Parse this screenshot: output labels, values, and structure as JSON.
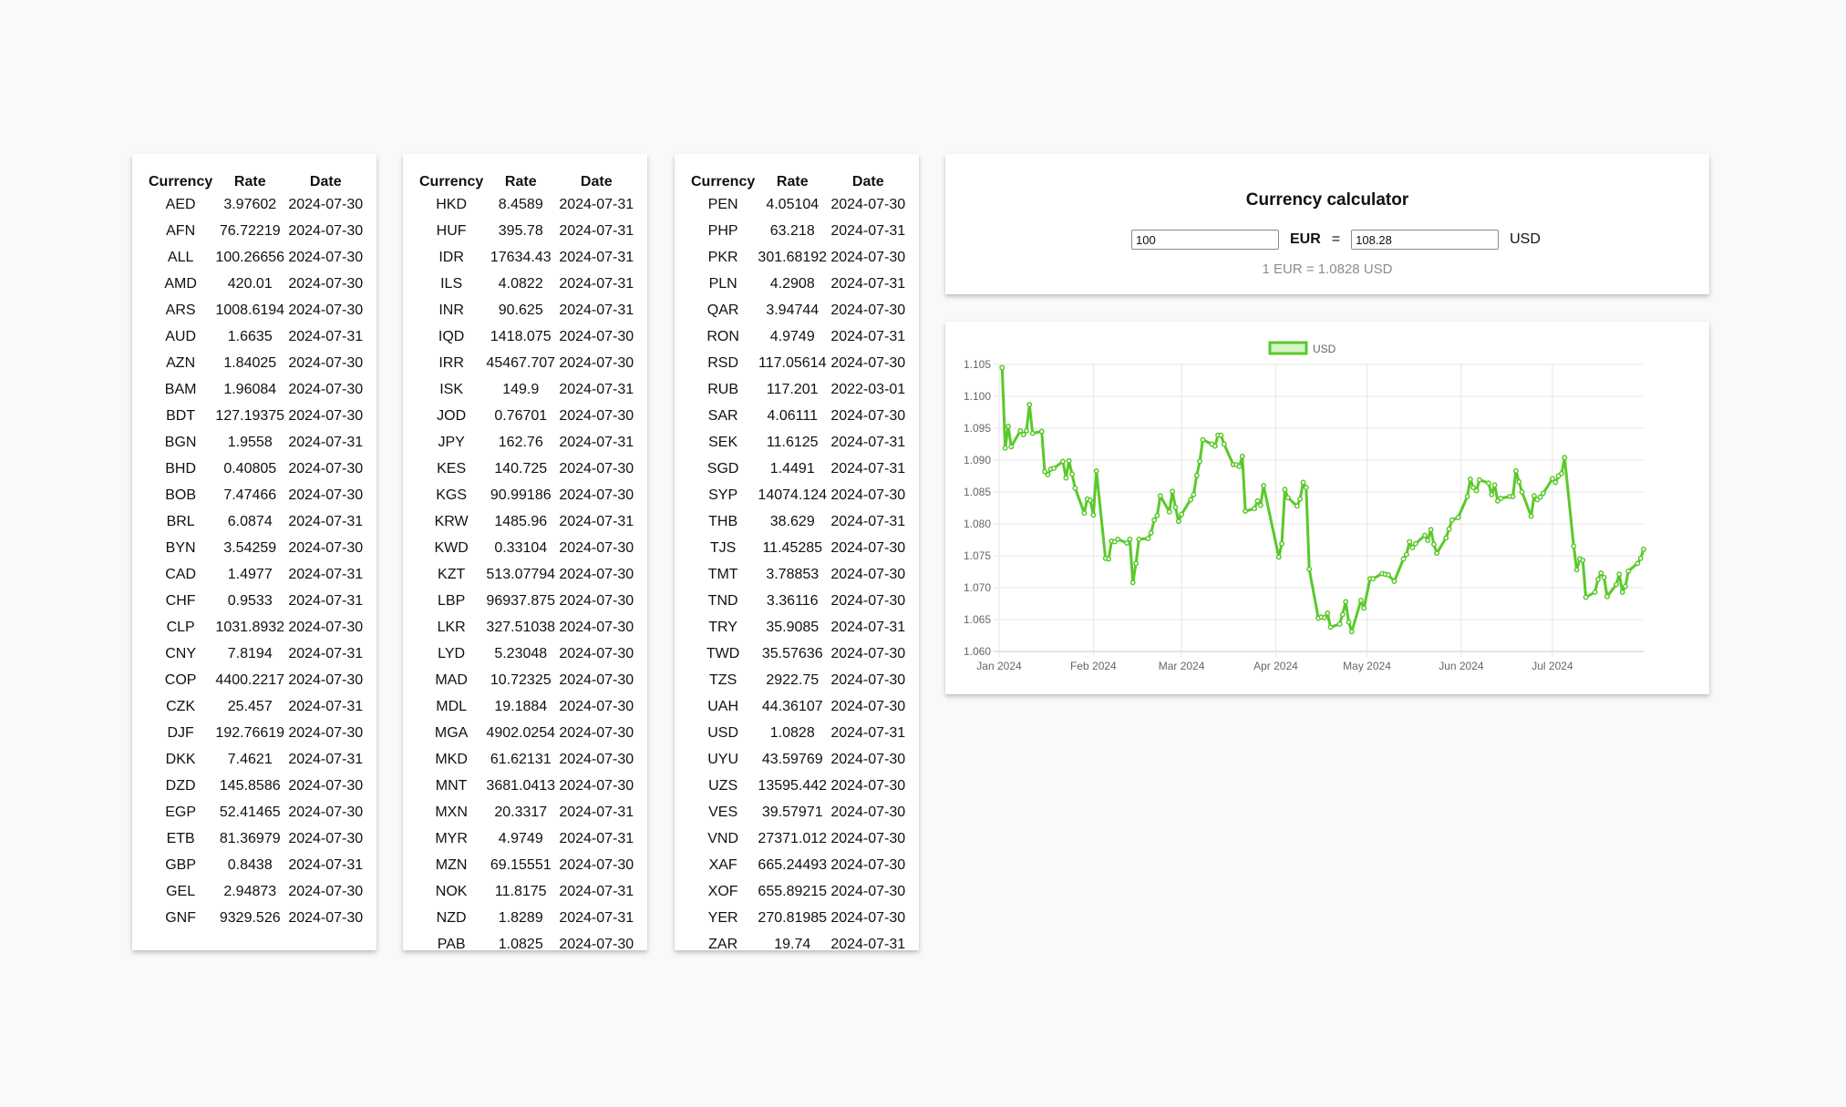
{
  "tables": [
    {
      "headers": {
        "currency": "Currency",
        "rate": "Rate",
        "date": "Date"
      },
      "rows": [
        [
          "AED",
          "3.97602",
          "2024-07-30"
        ],
        [
          "AFN",
          "76.72219",
          "2024-07-30"
        ],
        [
          "ALL",
          "100.26656",
          "2024-07-30"
        ],
        [
          "AMD",
          "420.01",
          "2024-07-30"
        ],
        [
          "ARS",
          "1008.6194",
          "2024-07-30"
        ],
        [
          "AUD",
          "1.6635",
          "2024-07-31"
        ],
        [
          "AZN",
          "1.84025",
          "2024-07-30"
        ],
        [
          "BAM",
          "1.96084",
          "2024-07-30"
        ],
        [
          "BDT",
          "127.19375",
          "2024-07-30"
        ],
        [
          "BGN",
          "1.9558",
          "2024-07-31"
        ],
        [
          "BHD",
          "0.40805",
          "2024-07-30"
        ],
        [
          "BOB",
          "7.47466",
          "2024-07-30"
        ],
        [
          "BRL",
          "6.0874",
          "2024-07-31"
        ],
        [
          "BYN",
          "3.54259",
          "2024-07-30"
        ],
        [
          "CAD",
          "1.4977",
          "2024-07-31"
        ],
        [
          "CHF",
          "0.9533",
          "2024-07-31"
        ],
        [
          "CLP",
          "1031.8932",
          "2024-07-30"
        ],
        [
          "CNY",
          "7.8194",
          "2024-07-31"
        ],
        [
          "COP",
          "4400.2217",
          "2024-07-30"
        ],
        [
          "CZK",
          "25.457",
          "2024-07-31"
        ],
        [
          "DJF",
          "192.76619",
          "2024-07-30"
        ],
        [
          "DKK",
          "7.4621",
          "2024-07-31"
        ],
        [
          "DZD",
          "145.8586",
          "2024-07-30"
        ],
        [
          "EGP",
          "52.41465",
          "2024-07-30"
        ],
        [
          "ETB",
          "81.36979",
          "2024-07-30"
        ],
        [
          "GBP",
          "0.8438",
          "2024-07-31"
        ],
        [
          "GEL",
          "2.94873",
          "2024-07-30"
        ],
        [
          "GNF",
          "9329.526",
          "2024-07-30"
        ]
      ]
    },
    {
      "headers": {
        "currency": "Currency",
        "rate": "Rate",
        "date": "Date"
      },
      "rows": [
        [
          "HKD",
          "8.4589",
          "2024-07-31"
        ],
        [
          "HUF",
          "395.78",
          "2024-07-31"
        ],
        [
          "IDR",
          "17634.43",
          "2024-07-31"
        ],
        [
          "ILS",
          "4.0822",
          "2024-07-31"
        ],
        [
          "INR",
          "90.625",
          "2024-07-31"
        ],
        [
          "IQD",
          "1418.075",
          "2024-07-30"
        ],
        [
          "IRR",
          "45467.707",
          "2024-07-30"
        ],
        [
          "ISK",
          "149.9",
          "2024-07-31"
        ],
        [
          "JOD",
          "0.76701",
          "2024-07-30"
        ],
        [
          "JPY",
          "162.76",
          "2024-07-31"
        ],
        [
          "KES",
          "140.725",
          "2024-07-30"
        ],
        [
          "KGS",
          "90.99186",
          "2024-07-30"
        ],
        [
          "KRW",
          "1485.96",
          "2024-07-31"
        ],
        [
          "KWD",
          "0.33104",
          "2024-07-30"
        ],
        [
          "KZT",
          "513.07794",
          "2024-07-30"
        ],
        [
          "LBP",
          "96937.875",
          "2024-07-30"
        ],
        [
          "LKR",
          "327.51038",
          "2024-07-30"
        ],
        [
          "LYD",
          "5.23048",
          "2024-07-30"
        ],
        [
          "MAD",
          "10.72325",
          "2024-07-30"
        ],
        [
          "MDL",
          "19.1884",
          "2024-07-30"
        ],
        [
          "MGA",
          "4902.0254",
          "2024-07-30"
        ],
        [
          "MKD",
          "61.62131",
          "2024-07-30"
        ],
        [
          "MNT",
          "3681.0413",
          "2024-07-30"
        ],
        [
          "MXN",
          "20.3317",
          "2024-07-31"
        ],
        [
          "MYR",
          "4.9749",
          "2024-07-31"
        ],
        [
          "MZN",
          "69.15551",
          "2024-07-30"
        ],
        [
          "NOK",
          "11.8175",
          "2024-07-31"
        ],
        [
          "NZD",
          "1.8289",
          "2024-07-31"
        ],
        [
          "PAB",
          "1.0825",
          "2024-07-30"
        ]
      ]
    },
    {
      "headers": {
        "currency": "Currency",
        "rate": "Rate",
        "date": "Date"
      },
      "rows": [
        [
          "PEN",
          "4.05104",
          "2024-07-30"
        ],
        [
          "PHP",
          "63.218",
          "2024-07-31"
        ],
        [
          "PKR",
          "301.68192",
          "2024-07-30"
        ],
        [
          "PLN",
          "4.2908",
          "2024-07-31"
        ],
        [
          "QAR",
          "3.94744",
          "2024-07-30"
        ],
        [
          "RON",
          "4.9749",
          "2024-07-31"
        ],
        [
          "RSD",
          "117.05614",
          "2024-07-30"
        ],
        [
          "RUB",
          "117.201",
          "2022-03-01"
        ],
        [
          "SAR",
          "4.06111",
          "2024-07-30"
        ],
        [
          "SEK",
          "11.6125",
          "2024-07-31"
        ],
        [
          "SGD",
          "1.4491",
          "2024-07-31"
        ],
        [
          "SYP",
          "14074.124",
          "2024-07-30"
        ],
        [
          "THB",
          "38.629",
          "2024-07-31"
        ],
        [
          "TJS",
          "11.45285",
          "2024-07-30"
        ],
        [
          "TMT",
          "3.78853",
          "2024-07-30"
        ],
        [
          "TND",
          "3.36116",
          "2024-07-30"
        ],
        [
          "TRY",
          "35.9085",
          "2024-07-31"
        ],
        [
          "TWD",
          "35.57636",
          "2024-07-30"
        ],
        [
          "TZS",
          "2922.75",
          "2024-07-30"
        ],
        [
          "UAH",
          "44.36107",
          "2024-07-30"
        ],
        [
          "USD",
          "1.0828",
          "2024-07-31"
        ],
        [
          "UYU",
          "43.59769",
          "2024-07-30"
        ],
        [
          "UZS",
          "13595.442",
          "2024-07-30"
        ],
        [
          "VES",
          "39.57971",
          "2024-07-30"
        ],
        [
          "VND",
          "27371.012",
          "2024-07-30"
        ],
        [
          "XAF",
          "665.24493",
          "2024-07-30"
        ],
        [
          "XOF",
          "655.89215",
          "2024-07-30"
        ],
        [
          "YER",
          "270.81985",
          "2024-07-30"
        ],
        [
          "ZAR",
          "19.74",
          "2024-07-31"
        ]
      ]
    }
  ],
  "calculator": {
    "title": "Currency calculator",
    "from_value": "100",
    "from_currency": "EUR",
    "equals": "=",
    "to_value": "108.28",
    "to_currency": "USD",
    "rate_line": "1 EUR = 1.0828 USD"
  },
  "chart_data": {
    "type": "line",
    "legend": "USD",
    "legend_position": "top",
    "series_color": "#5ac92a",
    "grid": true,
    "xlim": [
      "2024-01-01",
      "2024-07-31"
    ],
    "ylim": [
      1.06,
      1.105
    ],
    "x_ticks": [
      "2024-01-01",
      "2024-02-01",
      "2024-03-01",
      "2024-04-01",
      "2024-05-01",
      "2024-06-01",
      "2024-07-01"
    ],
    "x_tick_labels": [
      "Jan 2024",
      "Feb 2024",
      "Mar 2024",
      "Apr 2024",
      "May 2024",
      "Jun 2024",
      "Jul 2024"
    ],
    "y_ticks": [
      1.06,
      1.065,
      1.07,
      1.075,
      1.08,
      1.085,
      1.09,
      1.095,
      1.1,
      1.105
    ],
    "y_tick_labels": [
      "1.060",
      "1.065",
      "1.070",
      "1.075",
      "1.080",
      "1.085",
      "1.090",
      "1.095",
      "1.100",
      "1.105"
    ],
    "series": [
      {
        "name": "USD",
        "points": [
          [
            "2024-01-02",
            1.1045
          ],
          [
            "2024-01-03",
            1.0919
          ],
          [
            "2024-01-04",
            1.0953
          ],
          [
            "2024-01-05",
            1.0921
          ],
          [
            "2024-01-08",
            1.0946
          ],
          [
            "2024-01-09",
            1.094
          ],
          [
            "2024-01-10",
            1.0946
          ],
          [
            "2024-01-11",
            1.0987
          ],
          [
            "2024-01-12",
            1.0942
          ],
          [
            "2024-01-15",
            1.0945
          ],
          [
            "2024-01-16",
            1.0882
          ],
          [
            "2024-01-17",
            1.0877
          ],
          [
            "2024-01-18",
            1.0886
          ],
          [
            "2024-01-19",
            1.0887
          ],
          [
            "2024-01-22",
            1.0898
          ],
          [
            "2024-01-23",
            1.0872
          ],
          [
            "2024-01-24",
            1.0899
          ],
          [
            "2024-01-25",
            1.0878
          ],
          [
            "2024-01-26",
            1.0856
          ],
          [
            "2024-01-29",
            1.0817
          ],
          [
            "2024-01-30",
            1.0839
          ],
          [
            "2024-01-31",
            1.0837
          ],
          [
            "2024-02-01",
            1.0814
          ],
          [
            "2024-02-02",
            1.0883
          ],
          [
            "2024-02-05",
            1.0746
          ],
          [
            "2024-02-06",
            1.0745
          ],
          [
            "2024-02-07",
            1.0773
          ],
          [
            "2024-02-08",
            1.0772
          ],
          [
            "2024-02-09",
            1.0776
          ],
          [
            "2024-02-12",
            1.077
          ],
          [
            "2024-02-13",
            1.0776
          ],
          [
            "2024-02-14",
            1.0708
          ],
          [
            "2024-02-15",
            1.0738
          ],
          [
            "2024-02-16",
            1.0776
          ],
          [
            "2024-02-19",
            1.0777
          ],
          [
            "2024-02-20",
            1.0786
          ],
          [
            "2024-02-21",
            1.0806
          ],
          [
            "2024-02-22",
            1.0813
          ],
          [
            "2024-02-23",
            1.0844
          ],
          [
            "2024-02-26",
            1.0819
          ],
          [
            "2024-02-27",
            1.0851
          ],
          [
            "2024-02-28",
            1.0826
          ],
          [
            "2024-02-29",
            1.0804
          ],
          [
            "2024-03-01",
            1.0815
          ],
          [
            "2024-03-04",
            1.0838
          ],
          [
            "2024-03-05",
            1.0846
          ],
          [
            "2024-03-06",
            1.0876
          ],
          [
            "2024-03-07",
            1.0898
          ],
          [
            "2024-03-08",
            1.0932
          ],
          [
            "2024-03-11",
            1.0925
          ],
          [
            "2024-03-12",
            1.0922
          ],
          [
            "2024-03-13",
            1.0939
          ],
          [
            "2024-03-14",
            1.0939
          ],
          [
            "2024-03-15",
            1.0925
          ],
          [
            "2024-03-18",
            1.0893
          ],
          [
            "2024-03-19",
            1.0893
          ],
          [
            "2024-03-20",
            1.089
          ],
          [
            "2024-03-21",
            1.0906
          ],
          [
            "2024-03-22",
            1.082
          ],
          [
            "2024-03-25",
            1.0824
          ],
          [
            "2024-03-26",
            1.0836
          ],
          [
            "2024-03-27",
            1.0829
          ],
          [
            "2024-03-28",
            1.086
          ],
          [
            "2024-04-02",
            1.0748
          ],
          [
            "2024-04-03",
            1.0769
          ],
          [
            "2024-04-04",
            1.0854
          ],
          [
            "2024-04-05",
            1.0841
          ],
          [
            "2024-04-08",
            1.0828
          ],
          [
            "2024-04-09",
            1.0839
          ],
          [
            "2024-04-10",
            1.0865
          ],
          [
            "2024-04-11",
            1.0857
          ],
          [
            "2024-04-12",
            1.0729
          ],
          [
            "2024-04-15",
            1.0652
          ],
          [
            "2024-04-16",
            1.0654
          ],
          [
            "2024-04-17",
            1.0653
          ],
          [
            "2024-04-18",
            1.066
          ],
          [
            "2024-04-19",
            1.0638
          ],
          [
            "2024-04-22",
            1.0643
          ],
          [
            "2024-04-23",
            1.0658
          ],
          [
            "2024-04-24",
            1.0678
          ],
          [
            "2024-04-25",
            1.0646
          ],
          [
            "2024-04-26",
            1.0631
          ],
          [
            "2024-04-29",
            1.068
          ],
          [
            "2024-04-30",
            1.0668
          ],
          [
            "2024-05-02",
            1.0714
          ],
          [
            "2024-05-03",
            1.0714
          ],
          [
            "2024-05-06",
            1.0722
          ],
          [
            "2024-05-07",
            1.0721
          ],
          [
            "2024-05-08",
            1.072
          ],
          [
            "2024-05-10",
            1.071
          ],
          [
            "2024-05-13",
            1.0745
          ],
          [
            "2024-05-14",
            1.0752
          ],
          [
            "2024-05-15",
            1.0772
          ],
          [
            "2024-05-16",
            1.0763
          ],
          [
            "2024-05-17",
            1.0769
          ],
          [
            "2024-05-20",
            1.0782
          ],
          [
            "2024-05-21",
            1.0774
          ],
          [
            "2024-05-22",
            1.0791
          ],
          [
            "2024-05-23",
            1.0768
          ],
          [
            "2024-05-24",
            1.0754
          ],
          [
            "2024-05-27",
            1.0778
          ],
          [
            "2024-05-28",
            1.0792
          ],
          [
            "2024-05-29",
            1.0806
          ],
          [
            "2024-05-31",
            1.081
          ],
          [
            "2024-06-03",
            1.0843
          ],
          [
            "2024-06-04",
            1.087
          ],
          [
            "2024-06-05",
            1.0857
          ],
          [
            "2024-06-06",
            1.0852
          ],
          [
            "2024-06-07",
            1.0869
          ],
          [
            "2024-06-10",
            1.0864
          ],
          [
            "2024-06-11",
            1.0846
          ],
          [
            "2024-06-12",
            1.0861
          ],
          [
            "2024-06-13",
            1.0836
          ],
          [
            "2024-06-14",
            1.084
          ],
          [
            "2024-06-17",
            1.0843
          ],
          [
            "2024-06-18",
            1.0843
          ],
          [
            "2024-06-19",
            1.0883
          ],
          [
            "2024-06-20",
            1.0866
          ],
          [
            "2024-06-21",
            1.085
          ],
          [
            "2024-06-24",
            1.0812
          ],
          [
            "2024-06-25",
            1.0844
          ],
          [
            "2024-06-26",
            1.0838
          ],
          [
            "2024-06-27",
            1.0842
          ],
          [
            "2024-06-28",
            1.0848
          ],
          [
            "2024-07-01",
            1.0871
          ],
          [
            "2024-07-02",
            1.0865
          ],
          [
            "2024-07-03",
            1.0875
          ],
          [
            "2024-07-04",
            1.0879
          ],
          [
            "2024-07-05",
            1.0904
          ],
          [
            "2024-07-08",
            1.0765
          ],
          [
            "2024-07-09",
            1.0728
          ],
          [
            "2024-07-10",
            1.0745
          ],
          [
            "2024-07-11",
            1.0743
          ],
          [
            "2024-07-12",
            1.0685
          ],
          [
            "2024-07-15",
            1.0693
          ],
          [
            "2024-07-16",
            1.0713
          ],
          [
            "2024-07-17",
            1.0723
          ],
          [
            "2024-07-18",
            1.0716
          ],
          [
            "2024-07-19",
            1.0686
          ],
          [
            "2024-07-22",
            1.0705
          ],
          [
            "2024-07-23",
            1.0721
          ],
          [
            "2024-07-24",
            1.0693
          ],
          [
            "2024-07-25",
            1.0702
          ],
          [
            "2024-07-26",
            1.0726
          ],
          [
            "2024-07-29",
            1.0738
          ],
          [
            "2024-07-30",
            1.0746
          ],
          [
            "2024-07-31",
            1.076
          ]
        ]
      }
    ]
  }
}
